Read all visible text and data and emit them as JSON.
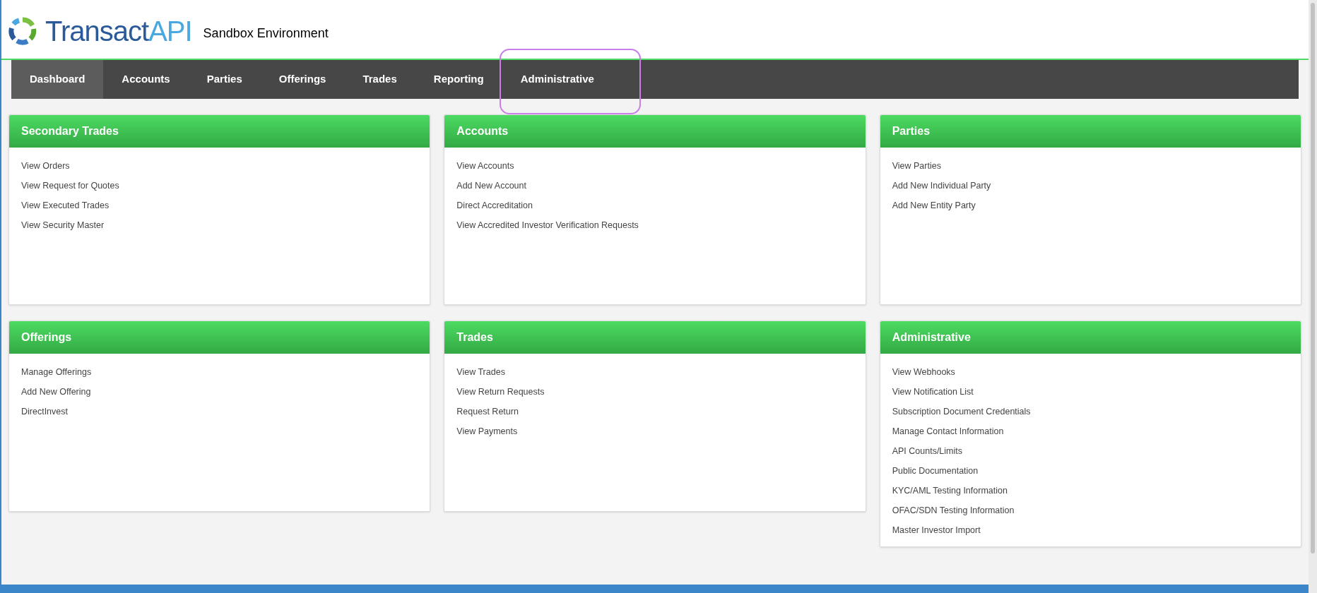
{
  "header": {
    "logo": {
      "main": "Transact",
      "accent": "API"
    },
    "environment": "Sandbox Environment"
  },
  "nav": [
    {
      "label": "Dashboard",
      "selected": true,
      "highlighted": false
    },
    {
      "label": "Accounts",
      "selected": false,
      "highlighted": false
    },
    {
      "label": "Parties",
      "selected": false,
      "highlighted": false
    },
    {
      "label": "Offerings",
      "selected": false,
      "highlighted": false
    },
    {
      "label": "Trades",
      "selected": false,
      "highlighted": false
    },
    {
      "label": "Reporting",
      "selected": false,
      "highlighted": false
    },
    {
      "label": "Administrative",
      "selected": false,
      "highlighted": true
    }
  ],
  "panel_rows": [
    [
      {
        "title": "Secondary Trades",
        "links": [
          "View Orders",
          "View Request for Quotes",
          "View Executed Trades",
          "View Security Master"
        ]
      },
      {
        "title": "Accounts",
        "links": [
          "View Accounts",
          "Add New Account",
          "Direct Accreditation",
          "View Accredited Investor Verification Requests"
        ]
      },
      {
        "title": "Parties",
        "links": [
          "View Parties",
          "Add New Individual Party",
          "Add New Entity Party"
        ]
      }
    ],
    [
      {
        "title": "Offerings",
        "links": [
          "Manage Offerings",
          "Add New Offering",
          "DirectInvest"
        ]
      },
      {
        "title": "Trades",
        "links": [
          "View Trades",
          "View Return Requests",
          "Request Return",
          "View Payments"
        ]
      },
      {
        "title": "Administrative",
        "links": [
          "View Webhooks",
          "View Notification List",
          "Subscription Document Credentials",
          "Manage Contact Information",
          "API Counts/Limits",
          "Public Documentation",
          "KYC/AML Testing Information",
          "OFAC/SDN Testing Information",
          "Master Investor Import"
        ]
      }
    ]
  ]
}
